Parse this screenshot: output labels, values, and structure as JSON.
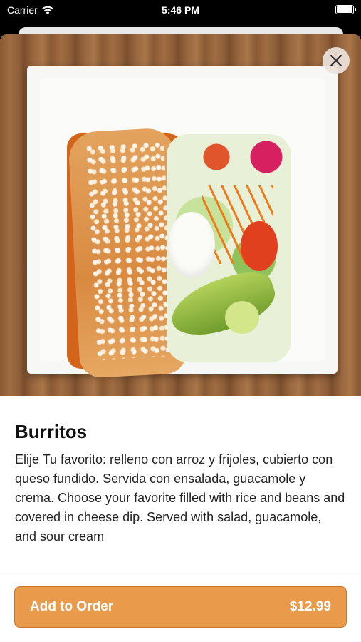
{
  "status_bar": {
    "carrier": "Carrier",
    "time": "5:46 PM",
    "icons": [
      "wifi-icon",
      "battery-icon"
    ]
  },
  "item": {
    "image_subject": "burrito plate",
    "title": "Burritos",
    "description": "Elije Tu favorito: relleno con arroz y frijoles, cubierto con queso fundido. Servida con ensalada, guacamole y crema. Choose your favorite filled with rice and beans and covered in cheese dip. Served with salad, guacamole, and sour cream"
  },
  "order_button": {
    "label": "Add to Order",
    "price": "$12.99"
  },
  "colors": {
    "accent": "#e99a4b",
    "accent_border": "#c9742a"
  },
  "icons": {
    "close": "close-icon"
  }
}
